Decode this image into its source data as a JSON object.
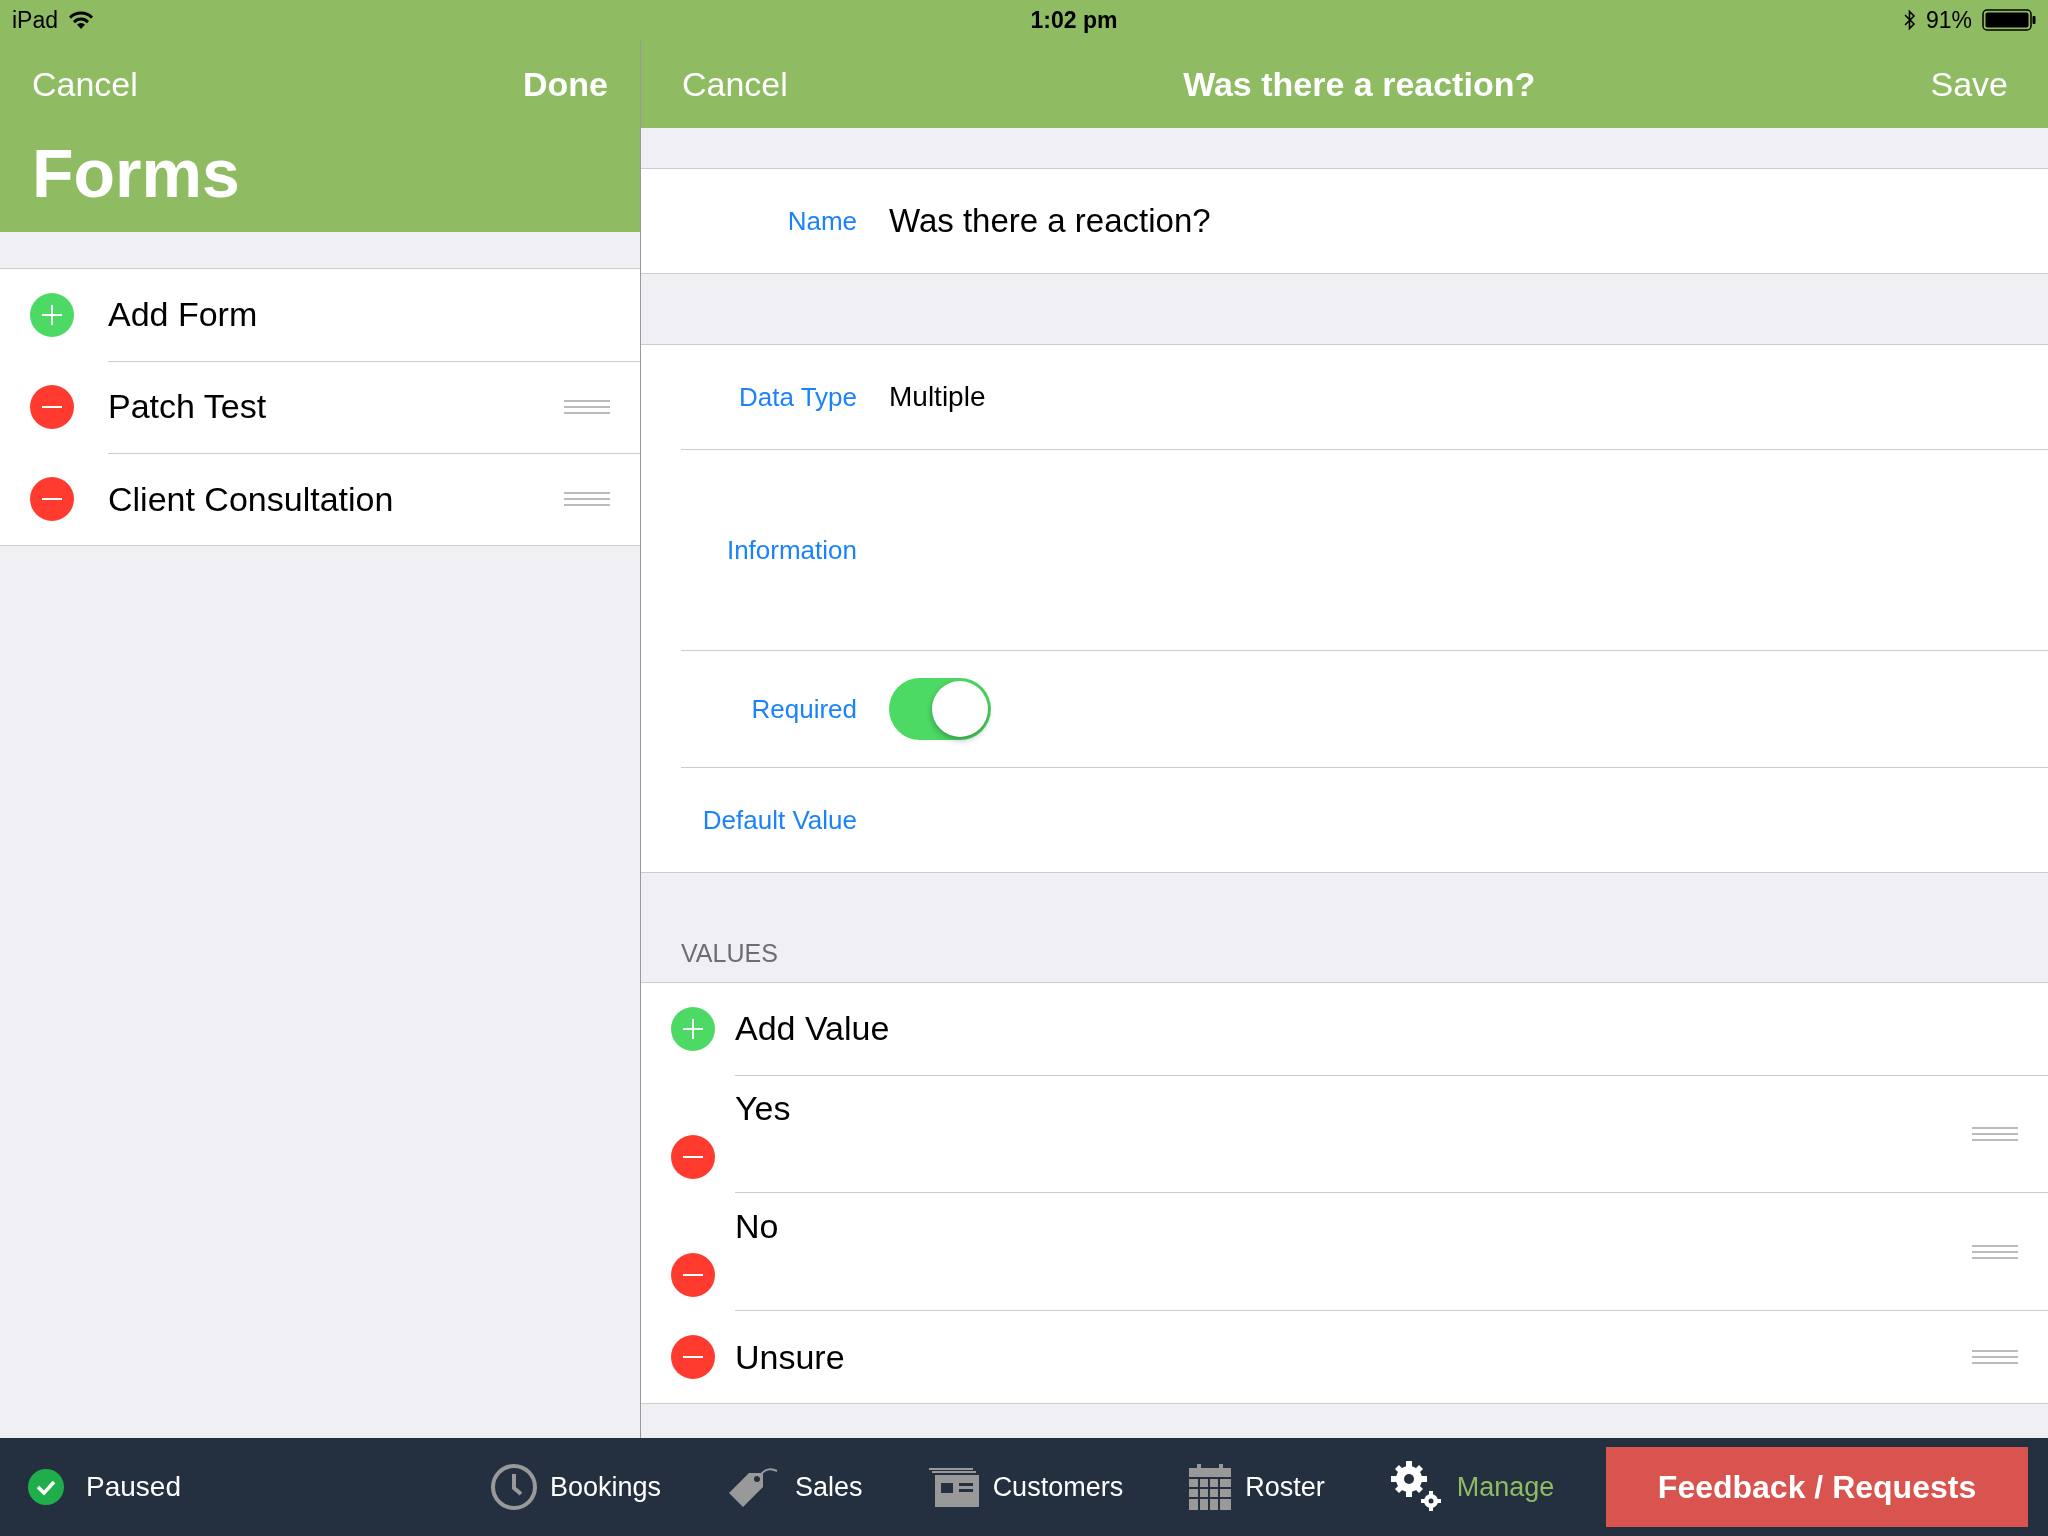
{
  "status_bar": {
    "device": "iPad",
    "time": "1:02 pm",
    "battery": "91%"
  },
  "left": {
    "cancel": "Cancel",
    "done": "Done",
    "title": "Forms",
    "items": [
      {
        "kind": "add",
        "label": "Add Form"
      },
      {
        "kind": "delete",
        "label": "Patch Test"
      },
      {
        "kind": "delete",
        "label": "Client Consultation"
      }
    ]
  },
  "right": {
    "cancel": "Cancel",
    "title": "Was there a reaction?",
    "save": "Save",
    "name": {
      "label": "Name",
      "value": "Was there a reaction?"
    },
    "fields": [
      {
        "kind": "value",
        "label": "Data Type",
        "value": "Multiple"
      },
      {
        "kind": "tall",
        "label": "Information"
      },
      {
        "kind": "toggle",
        "label": "Required",
        "on": true
      },
      {
        "kind": "value",
        "label": "Default Value"
      }
    ],
    "values_header": "VALUES",
    "values": [
      {
        "kind": "add",
        "label": "Add Value"
      },
      {
        "kind": "delete",
        "label": "Yes",
        "tall": true
      },
      {
        "kind": "delete",
        "label": "No",
        "tall": true
      },
      {
        "kind": "delete",
        "label": "Unsure",
        "tall": false
      }
    ]
  },
  "tab_bar": {
    "sync": {
      "label": "Paused"
    },
    "tabs": [
      {
        "kind": "clock",
        "label": "Bookings",
        "selected": false
      },
      {
        "kind": "tag",
        "label": "Sales",
        "selected": false
      },
      {
        "kind": "shop",
        "label": "Customers",
        "selected": false
      },
      {
        "kind": "calendar",
        "label": "Roster",
        "selected": false
      },
      {
        "kind": "gear",
        "label": "Manage",
        "selected": true
      }
    ],
    "feedback": "Feedback / Requests"
  }
}
